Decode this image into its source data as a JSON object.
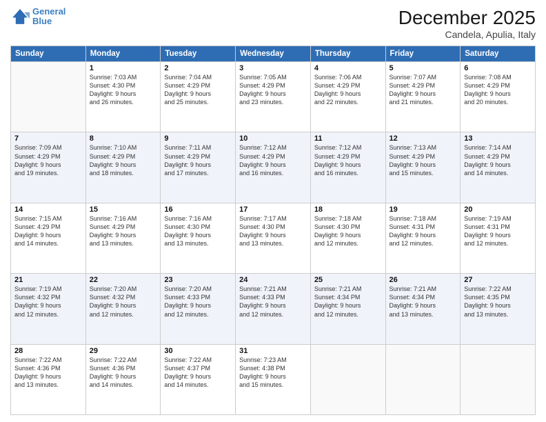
{
  "header": {
    "logo_line1": "General",
    "logo_line2": "Blue",
    "main_title": "December 2025",
    "sub_title": "Candela, Apulia, Italy"
  },
  "weekdays": [
    "Sunday",
    "Monday",
    "Tuesday",
    "Wednesday",
    "Thursday",
    "Friday",
    "Saturday"
  ],
  "weeks": [
    [
      {
        "day": "",
        "info": ""
      },
      {
        "day": "1",
        "info": "Sunrise: 7:03 AM\nSunset: 4:30 PM\nDaylight: 9 hours\nand 26 minutes."
      },
      {
        "day": "2",
        "info": "Sunrise: 7:04 AM\nSunset: 4:29 PM\nDaylight: 9 hours\nand 25 minutes."
      },
      {
        "day": "3",
        "info": "Sunrise: 7:05 AM\nSunset: 4:29 PM\nDaylight: 9 hours\nand 23 minutes."
      },
      {
        "day": "4",
        "info": "Sunrise: 7:06 AM\nSunset: 4:29 PM\nDaylight: 9 hours\nand 22 minutes."
      },
      {
        "day": "5",
        "info": "Sunrise: 7:07 AM\nSunset: 4:29 PM\nDaylight: 9 hours\nand 21 minutes."
      },
      {
        "day": "6",
        "info": "Sunrise: 7:08 AM\nSunset: 4:29 PM\nDaylight: 9 hours\nand 20 minutes."
      }
    ],
    [
      {
        "day": "7",
        "info": "Sunrise: 7:09 AM\nSunset: 4:29 PM\nDaylight: 9 hours\nand 19 minutes."
      },
      {
        "day": "8",
        "info": "Sunrise: 7:10 AM\nSunset: 4:29 PM\nDaylight: 9 hours\nand 18 minutes."
      },
      {
        "day": "9",
        "info": "Sunrise: 7:11 AM\nSunset: 4:29 PM\nDaylight: 9 hours\nand 17 minutes."
      },
      {
        "day": "10",
        "info": "Sunrise: 7:12 AM\nSunset: 4:29 PM\nDaylight: 9 hours\nand 16 minutes."
      },
      {
        "day": "11",
        "info": "Sunrise: 7:12 AM\nSunset: 4:29 PM\nDaylight: 9 hours\nand 16 minutes."
      },
      {
        "day": "12",
        "info": "Sunrise: 7:13 AM\nSunset: 4:29 PM\nDaylight: 9 hours\nand 15 minutes."
      },
      {
        "day": "13",
        "info": "Sunrise: 7:14 AM\nSunset: 4:29 PM\nDaylight: 9 hours\nand 14 minutes."
      }
    ],
    [
      {
        "day": "14",
        "info": "Sunrise: 7:15 AM\nSunset: 4:29 PM\nDaylight: 9 hours\nand 14 minutes."
      },
      {
        "day": "15",
        "info": "Sunrise: 7:16 AM\nSunset: 4:29 PM\nDaylight: 9 hours\nand 13 minutes."
      },
      {
        "day": "16",
        "info": "Sunrise: 7:16 AM\nSunset: 4:30 PM\nDaylight: 9 hours\nand 13 minutes."
      },
      {
        "day": "17",
        "info": "Sunrise: 7:17 AM\nSunset: 4:30 PM\nDaylight: 9 hours\nand 13 minutes."
      },
      {
        "day": "18",
        "info": "Sunrise: 7:18 AM\nSunset: 4:30 PM\nDaylight: 9 hours\nand 12 minutes."
      },
      {
        "day": "19",
        "info": "Sunrise: 7:18 AM\nSunset: 4:31 PM\nDaylight: 9 hours\nand 12 minutes."
      },
      {
        "day": "20",
        "info": "Sunrise: 7:19 AM\nSunset: 4:31 PM\nDaylight: 9 hours\nand 12 minutes."
      }
    ],
    [
      {
        "day": "21",
        "info": "Sunrise: 7:19 AM\nSunset: 4:32 PM\nDaylight: 9 hours\nand 12 minutes."
      },
      {
        "day": "22",
        "info": "Sunrise: 7:20 AM\nSunset: 4:32 PM\nDaylight: 9 hours\nand 12 minutes."
      },
      {
        "day": "23",
        "info": "Sunrise: 7:20 AM\nSunset: 4:33 PM\nDaylight: 9 hours\nand 12 minutes."
      },
      {
        "day": "24",
        "info": "Sunrise: 7:21 AM\nSunset: 4:33 PM\nDaylight: 9 hours\nand 12 minutes."
      },
      {
        "day": "25",
        "info": "Sunrise: 7:21 AM\nSunset: 4:34 PM\nDaylight: 9 hours\nand 12 minutes."
      },
      {
        "day": "26",
        "info": "Sunrise: 7:21 AM\nSunset: 4:34 PM\nDaylight: 9 hours\nand 13 minutes."
      },
      {
        "day": "27",
        "info": "Sunrise: 7:22 AM\nSunset: 4:35 PM\nDaylight: 9 hours\nand 13 minutes."
      }
    ],
    [
      {
        "day": "28",
        "info": "Sunrise: 7:22 AM\nSunset: 4:36 PM\nDaylight: 9 hours\nand 13 minutes."
      },
      {
        "day": "29",
        "info": "Sunrise: 7:22 AM\nSunset: 4:36 PM\nDaylight: 9 hours\nand 14 minutes."
      },
      {
        "day": "30",
        "info": "Sunrise: 7:22 AM\nSunset: 4:37 PM\nDaylight: 9 hours\nand 14 minutes."
      },
      {
        "day": "31",
        "info": "Sunrise: 7:23 AM\nSunset: 4:38 PM\nDaylight: 9 hours\nand 15 minutes."
      },
      {
        "day": "",
        "info": ""
      },
      {
        "day": "",
        "info": ""
      },
      {
        "day": "",
        "info": ""
      }
    ]
  ]
}
